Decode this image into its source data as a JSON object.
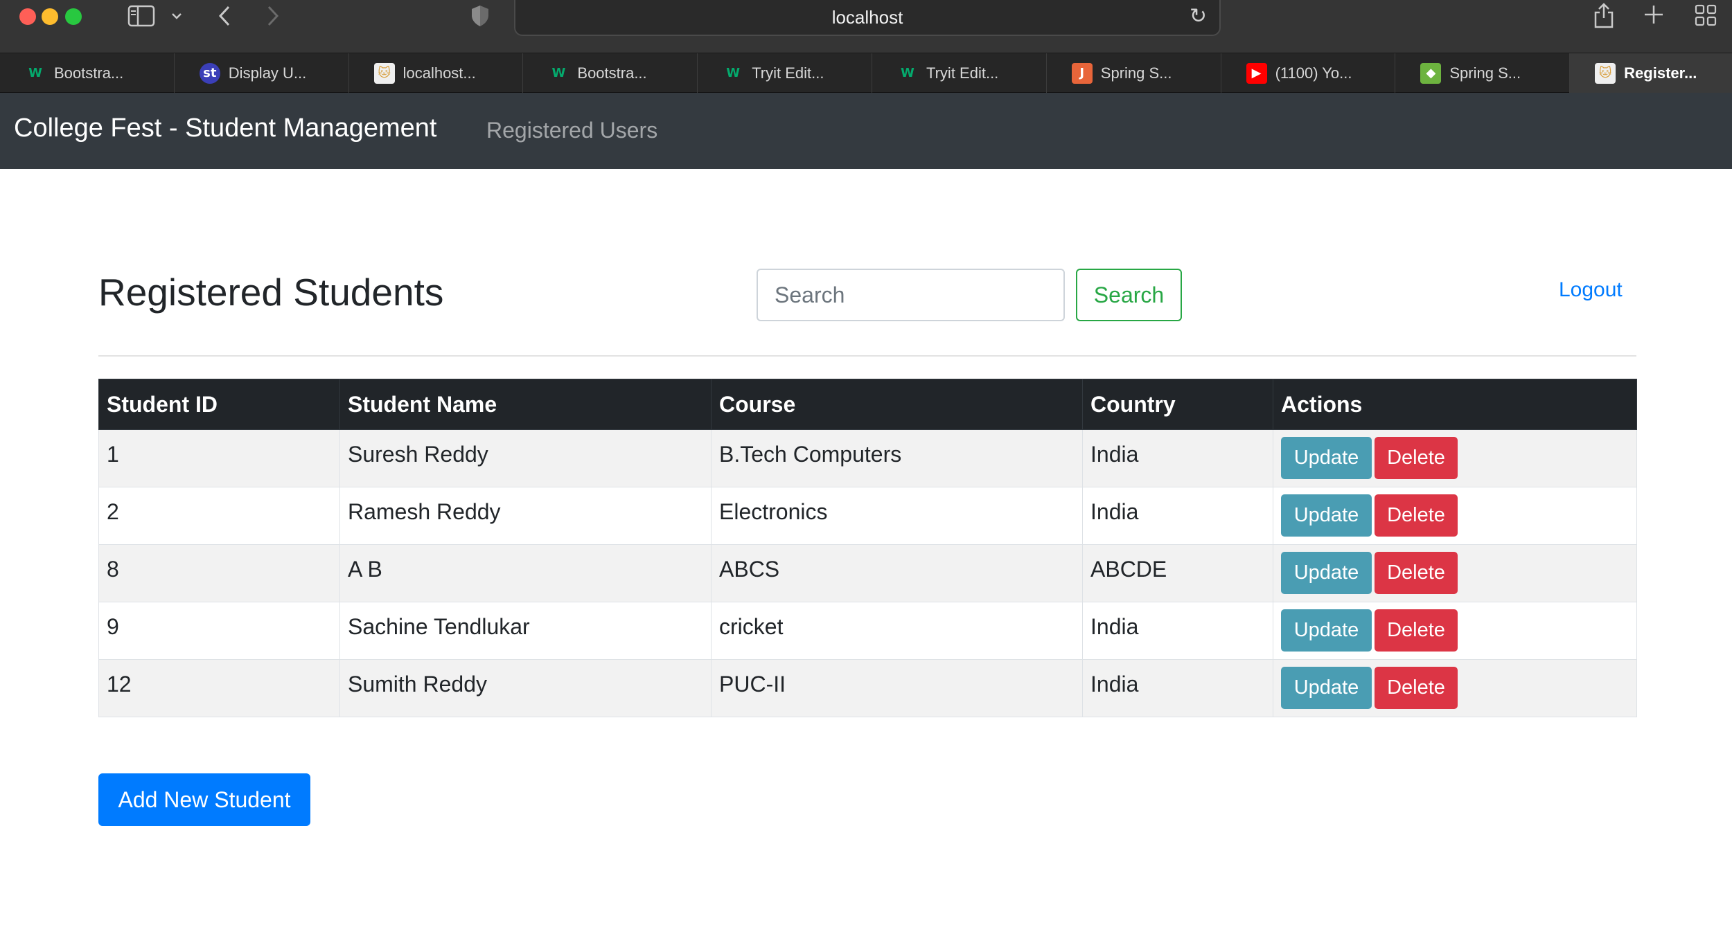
{
  "browser": {
    "address": "localhost",
    "tabs": [
      {
        "label": "Bootstra...",
        "icon": "w3schools-icon",
        "fav": "W",
        "favColor": "#04aa6d",
        "favBg": "transparent"
      },
      {
        "label": "Display U...",
        "icon": "studytonight-icon",
        "fav": "st",
        "favColor": "#ffffff",
        "favBg": "#3b3fb8"
      },
      {
        "label": "localhost...",
        "icon": "tomcat-icon",
        "fav": "🐱",
        "favColor": "#d8a040",
        "favBg": "#efefef"
      },
      {
        "label": "Bootstra...",
        "icon": "w3schools-icon",
        "fav": "W",
        "favColor": "#04aa6d",
        "favBg": "transparent"
      },
      {
        "label": "Tryit Edit...",
        "icon": "w3schools-icon",
        "fav": "W",
        "favColor": "#04aa6d",
        "favBg": "transparent"
      },
      {
        "label": "Tryit Edit...",
        "icon": "w3schools-icon",
        "fav": "W",
        "favColor": "#04aa6d",
        "favBg": "transparent"
      },
      {
        "label": "Spring S...",
        "icon": "javatpoint-icon",
        "fav": "J",
        "favColor": "#ffffff",
        "favBg": "#e8653a"
      },
      {
        "label": "(1100) Yo...",
        "icon": "youtube-icon",
        "fav": "▶",
        "favColor": "#ffffff",
        "favBg": "#ff0000"
      },
      {
        "label": "Spring S...",
        "icon": "spring-icon",
        "fav": "◆",
        "favColor": "#ffffff",
        "favBg": "#6db33f"
      },
      {
        "label": "Register...",
        "icon": "tomcat-icon",
        "fav": "🐱",
        "favColor": "#d8a040",
        "favBg": "#efefef",
        "active": true
      }
    ]
  },
  "navbar": {
    "brand": "College Fest - Student Management",
    "link": "Registered Users"
  },
  "main": {
    "title": "Registered Students",
    "search_placeholder": "Search",
    "search_button": "Search",
    "logout": "Logout",
    "add_button": "Add New Student"
  },
  "table": {
    "headers": [
      "Student ID",
      "Student Name",
      "Course",
      "Country",
      "Actions"
    ],
    "update_label": "Update",
    "delete_label": "Delete",
    "rows": [
      [
        "1",
        "Suresh Reddy",
        "B.Tech Computers",
        "India"
      ],
      [
        "2",
        "Ramesh Reddy",
        "Electronics",
        "India"
      ],
      [
        "8",
        "A B",
        "ABCS",
        "ABCDE"
      ],
      [
        "9",
        "Sachine Tendlukar",
        "cricket",
        "India"
      ],
      [
        "12",
        "Sumith Reddy",
        "PUC-II",
        "India"
      ]
    ]
  },
  "colors": {
    "navbar": "#343a40",
    "update": "#4a9db3",
    "delete": "#dc3545",
    "primary": "#007bff",
    "success": "#28a745"
  }
}
